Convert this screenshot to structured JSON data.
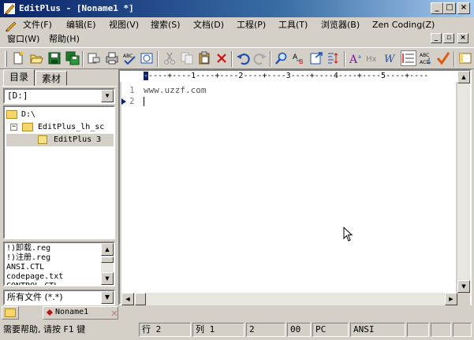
{
  "window": {
    "title": "EditPlus - [Noname1 *]",
    "accent": "#0a246a"
  },
  "menu": {
    "items": [
      "文件(F)",
      "编辑(E)",
      "视图(V)",
      "搜索(S)",
      "文档(D)",
      "工程(P)",
      "工具(T)",
      "浏览器(B)",
      "Zen Coding(Z)"
    ],
    "row2": [
      "窗口(W)",
      "帮助(H)"
    ]
  },
  "toolbar": {
    "icons": [
      "new-file-icon",
      "open-folder-icon",
      "save-icon",
      "save-all-icon",
      "print-preview-icon",
      "print-icon",
      "spellcheck-icon",
      "browser-preview-icon",
      "cut-icon",
      "copy-icon",
      "paste-icon",
      "delete-icon",
      "undo-icon",
      "redo-icon",
      "find-icon",
      "replace-icon",
      "goto-icon",
      "ruler-icon",
      "font-size-icon",
      "hex-icon",
      "word-wrap-icon",
      "line-number-icon",
      "sort-icon",
      "check-icon",
      "tool-panel-icon"
    ]
  },
  "sidebar": {
    "tabs": [
      "目录",
      "素材"
    ],
    "drive": "[D:]",
    "tree": [
      {
        "label": "D:\\",
        "level": 0
      },
      {
        "label": "EditPlus_lh_sc",
        "level": 1
      },
      {
        "label": "EditPlus 3",
        "level": 2
      }
    ],
    "files": [
      "!)卸载.reg",
      "!)注册.reg",
      "ANSI.CTL",
      "codepage.txt",
      "CONTROL.CTL"
    ],
    "filter": "所有文件 (*.*)"
  },
  "editor": {
    "ruler": "----+----1----+----2----+----3----+----4----+----5----+----",
    "lines": [
      {
        "num": "1",
        "text": "www.uzzf.com"
      },
      {
        "num": "2",
        "text": ""
      }
    ]
  },
  "doc_tab": {
    "label": "Noname1"
  },
  "status": {
    "help": "需要帮助, 请按 F1 键",
    "row": "行 2",
    "col": "列 1",
    "lines": "2",
    "pos": "00",
    "eol": "PC",
    "encoding": "ANSI"
  }
}
